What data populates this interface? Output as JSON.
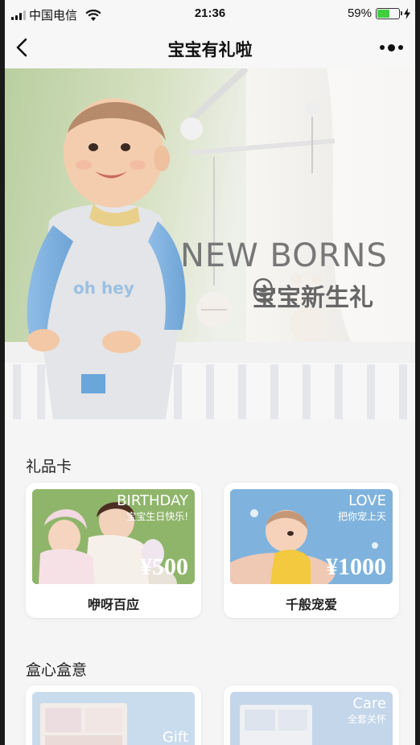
{
  "status": {
    "carrier": "中国电信",
    "time": "21:36",
    "battery_percent": "59%",
    "battery_level": 0.59
  },
  "nav": {
    "title": "宝宝有礼啦"
  },
  "banner": {
    "headline": "NEW BORNS",
    "subtitle": "宝宝新生礼"
  },
  "gift_cards": {
    "section_title": "礼品卡",
    "items": [
      {
        "tag": "BIRTHDAY",
        "tag_sub": "宝宝生日快乐!",
        "price": "¥500",
        "label": "咿呀百应"
      },
      {
        "tag": "LOVE",
        "tag_sub": "把你宠上天",
        "price": "¥1000",
        "label": "千般宠爱"
      }
    ]
  },
  "gift_boxes": {
    "section_title": "盒心盒意",
    "items": [
      {
        "tag": "Gift"
      },
      {
        "tag": "Care",
        "tag_sub": "全套关怀"
      }
    ]
  },
  "colors": {
    "battery_fill": "#3fcf3f",
    "card1_bg": "#8fb56a",
    "card2_bg": "#7fb3dd",
    "box_bg": "#c9dced"
  }
}
